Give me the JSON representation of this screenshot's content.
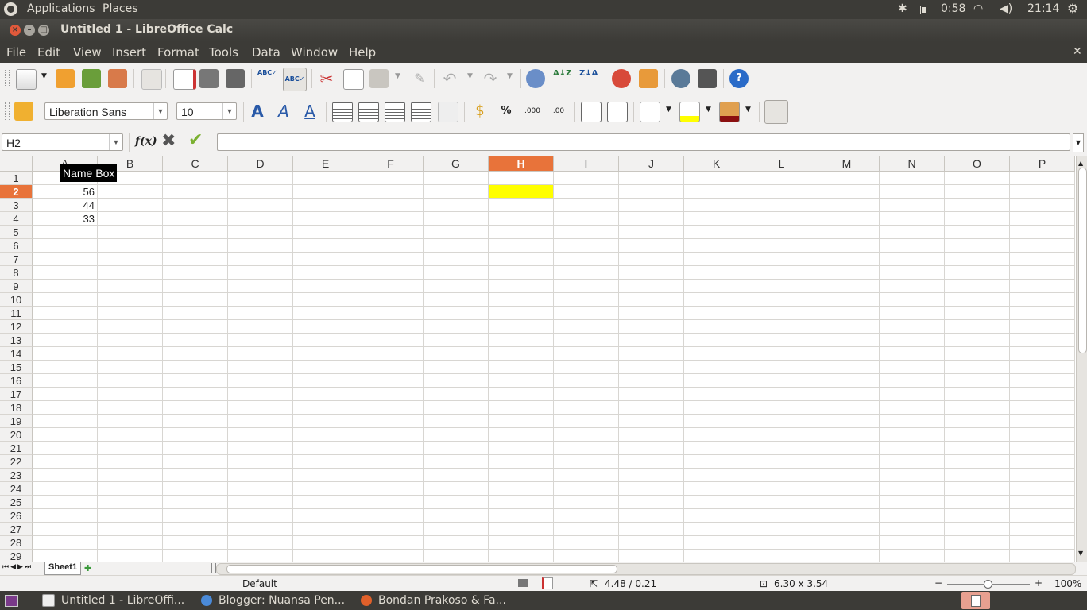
{
  "top_panel": {
    "applications": "Applications",
    "places": "Places",
    "battery_time": "0:58",
    "clock": "21:14"
  },
  "window": {
    "title": "Untitled 1 - LibreOffice Calc"
  },
  "menu": [
    {
      "label": "File"
    },
    {
      "label": "Edit"
    },
    {
      "label": "View"
    },
    {
      "label": "Insert"
    },
    {
      "label": "Format"
    },
    {
      "label": "Tools"
    },
    {
      "label": "Data"
    },
    {
      "label": "Window"
    },
    {
      "label": "Help"
    }
  ],
  "formatting": {
    "font_name": "Liberation Sans",
    "font_size": "10",
    "percent_label": "%"
  },
  "formula_bar": {
    "name_box": "H2",
    "fx_label": "f(x)",
    "formula_value": ""
  },
  "tooltip": {
    "text": "Name Box"
  },
  "sheet": {
    "columns": [
      "A",
      "B",
      "C",
      "D",
      "E",
      "F",
      "G",
      "H",
      "I",
      "J",
      "K",
      "L",
      "M",
      "N",
      "O",
      "P"
    ],
    "rows": [
      "1",
      "2",
      "3",
      "4",
      "5",
      "6",
      "7",
      "8",
      "9",
      "10",
      "11",
      "12",
      "13",
      "14",
      "15",
      "16",
      "17",
      "18",
      "19",
      "20",
      "21",
      "22",
      "23",
      "24",
      "25",
      "26",
      "27",
      "28",
      "29"
    ],
    "active_column": "H",
    "active_row": "2",
    "active_cell_fill": "#ffff00",
    "header_active_color": "#e8733a",
    "cells": [
      {
        "ref": "A2",
        "value": "56"
      },
      {
        "ref": "A3",
        "value": "44"
      },
      {
        "ref": "A4",
        "value": "33"
      }
    ],
    "tabs": [
      {
        "label": "Sheet1"
      }
    ]
  },
  "status_bar": {
    "page_style": "Default",
    "position": "4.48 / 0.21",
    "size": "6.30 x 3.54",
    "zoom": "100%"
  },
  "taskbar": [
    {
      "label": "Untitled 1 - LibreOffi..."
    },
    {
      "label": "Blogger: Nuansa Pen..."
    },
    {
      "label": "Bondan Prakoso & Fa..."
    }
  ]
}
